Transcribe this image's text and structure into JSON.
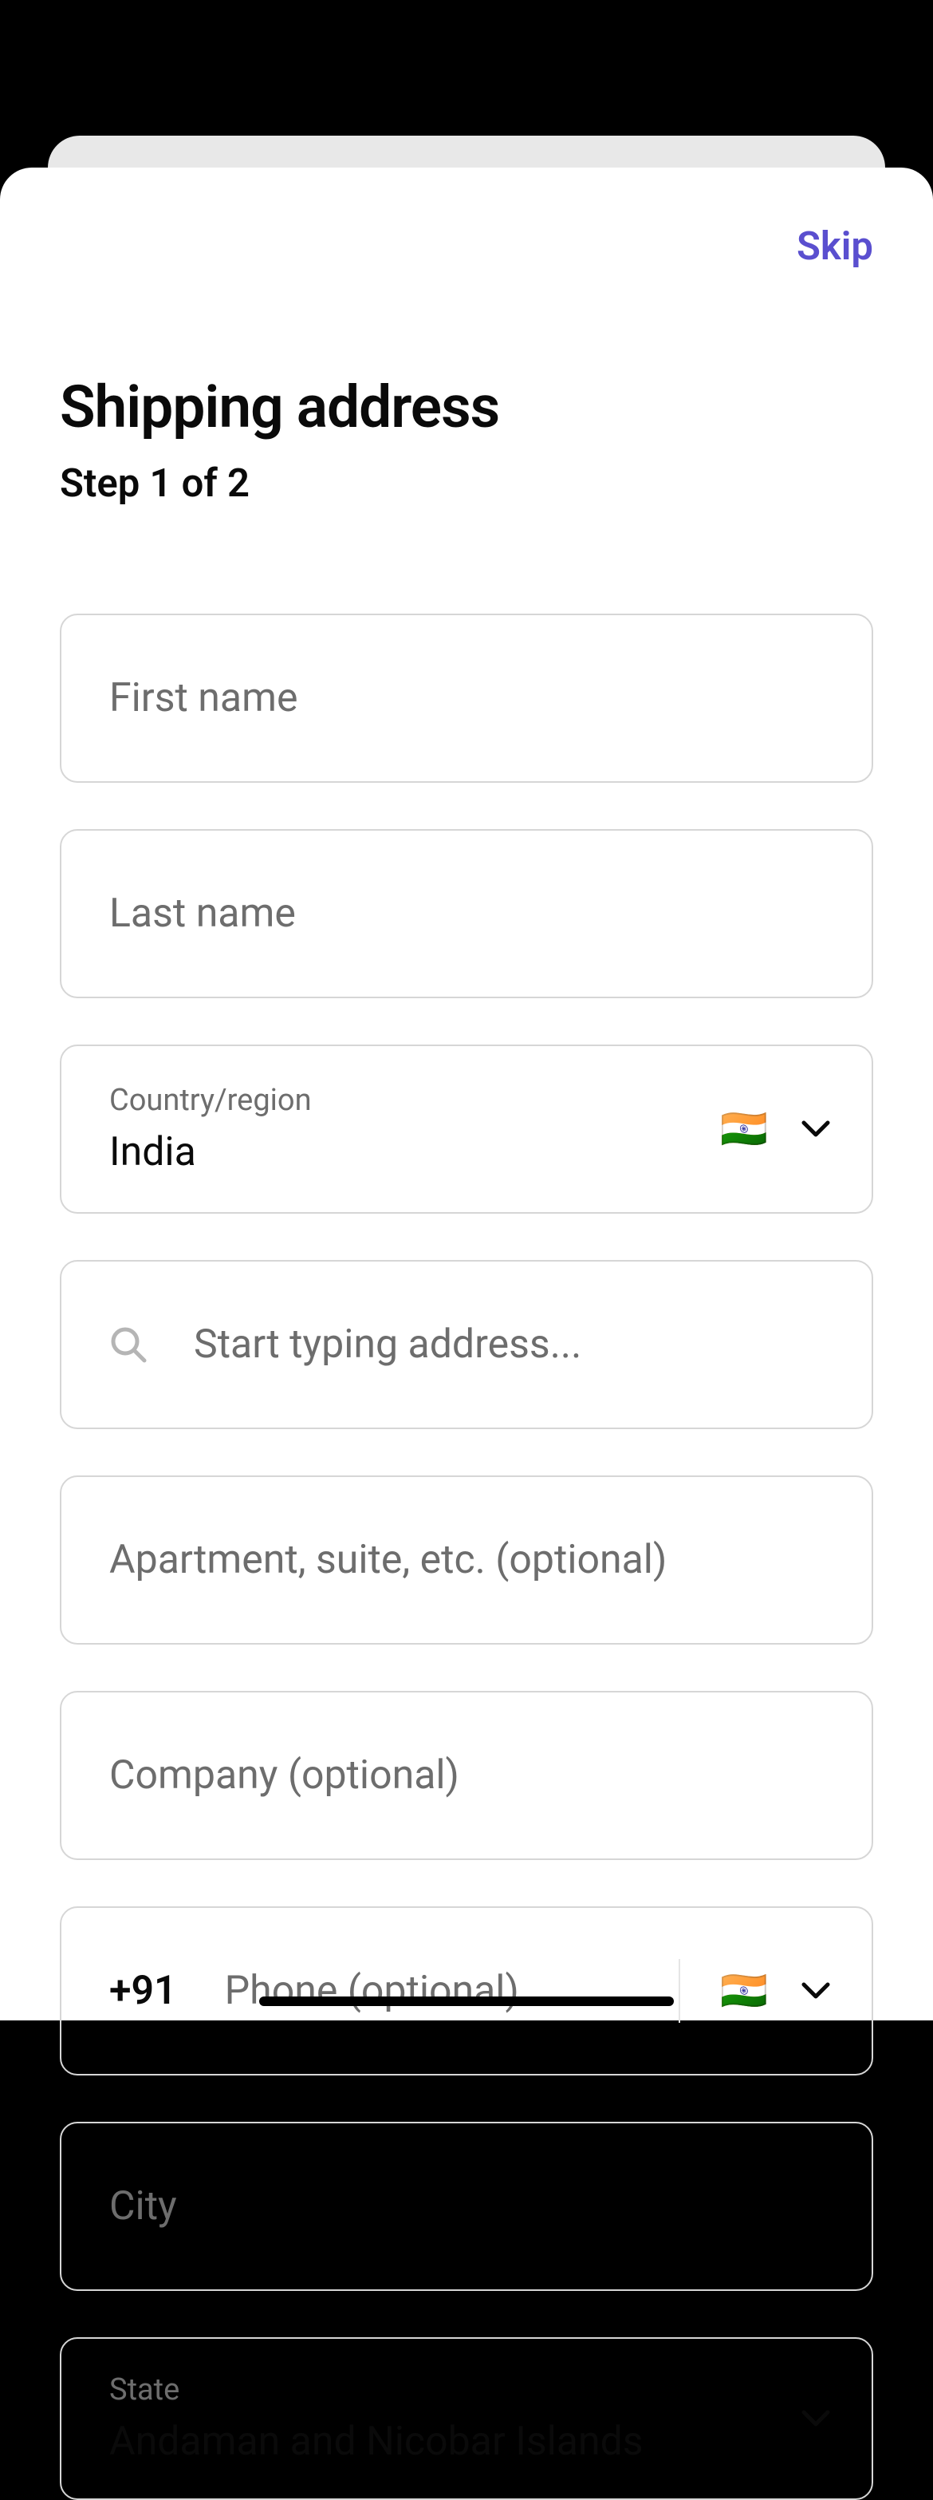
{
  "header": {
    "skip_label": "Skip"
  },
  "page": {
    "title": "Shipping address",
    "step": "Step 1 of 2"
  },
  "fields": {
    "first_name": {
      "placeholder": "First name",
      "value": ""
    },
    "last_name": {
      "placeholder": "Last name",
      "value": ""
    },
    "country": {
      "label": "Country/region",
      "value": "India",
      "flag": "🇮🇳"
    },
    "address": {
      "placeholder": "Start typing address...",
      "value": ""
    },
    "apartment": {
      "placeholder": "Apartment, suite, etc. (optional)",
      "value": ""
    },
    "company": {
      "placeholder": "Company (optional)",
      "value": ""
    },
    "phone": {
      "prefix": "+91",
      "placeholder": "Phone (optional)",
      "value": "",
      "flag": "🇮🇳"
    },
    "city": {
      "placeholder": "City",
      "value": ""
    },
    "state": {
      "label": "State",
      "value": "Andaman and Nicobar Islands"
    }
  }
}
